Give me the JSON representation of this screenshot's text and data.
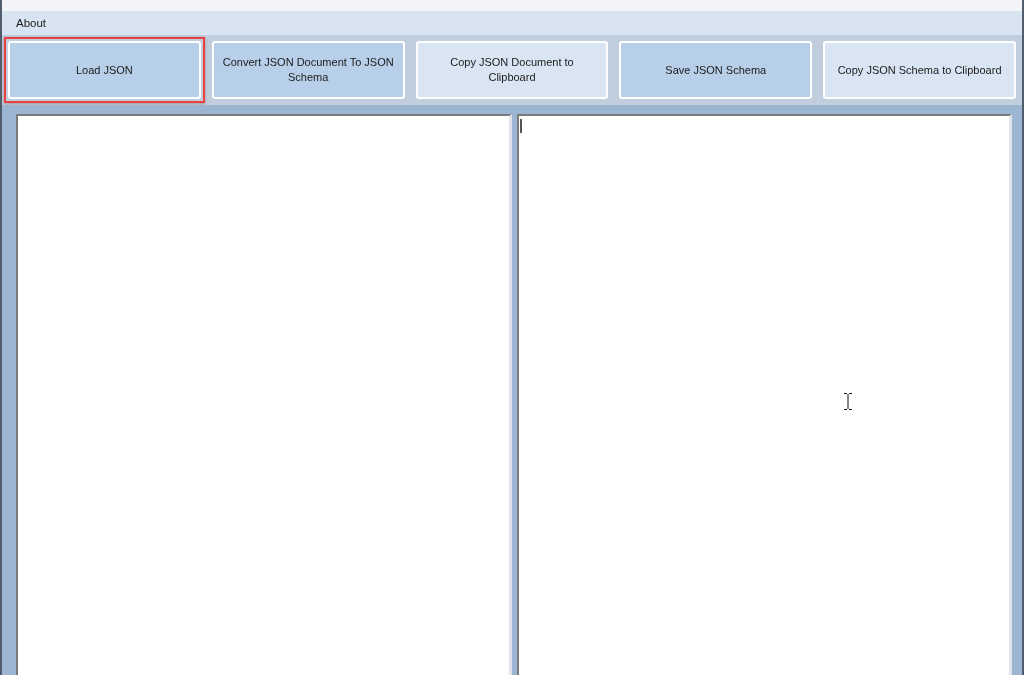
{
  "menu_bar": {
    "items": [
      {
        "label": "About"
      }
    ]
  },
  "toolbar": {
    "buttons": [
      {
        "label": "Load JSON",
        "kind": "accent",
        "highlighted": true
      },
      {
        "label": "Convert JSON Document To JSON Schema",
        "kind": "accent",
        "highlighted": false
      },
      {
        "label": "Copy JSON Document to Clipboard",
        "kind": "plain",
        "highlighted": false
      },
      {
        "label": "Save JSON Schema",
        "kind": "accent",
        "highlighted": false
      },
      {
        "label": "Copy JSON Schema to Clipboard",
        "kind": "plain",
        "highlighted": false
      }
    ]
  },
  "editors": [
    {
      "focused": false
    },
    {
      "focused": true
    }
  ]
}
